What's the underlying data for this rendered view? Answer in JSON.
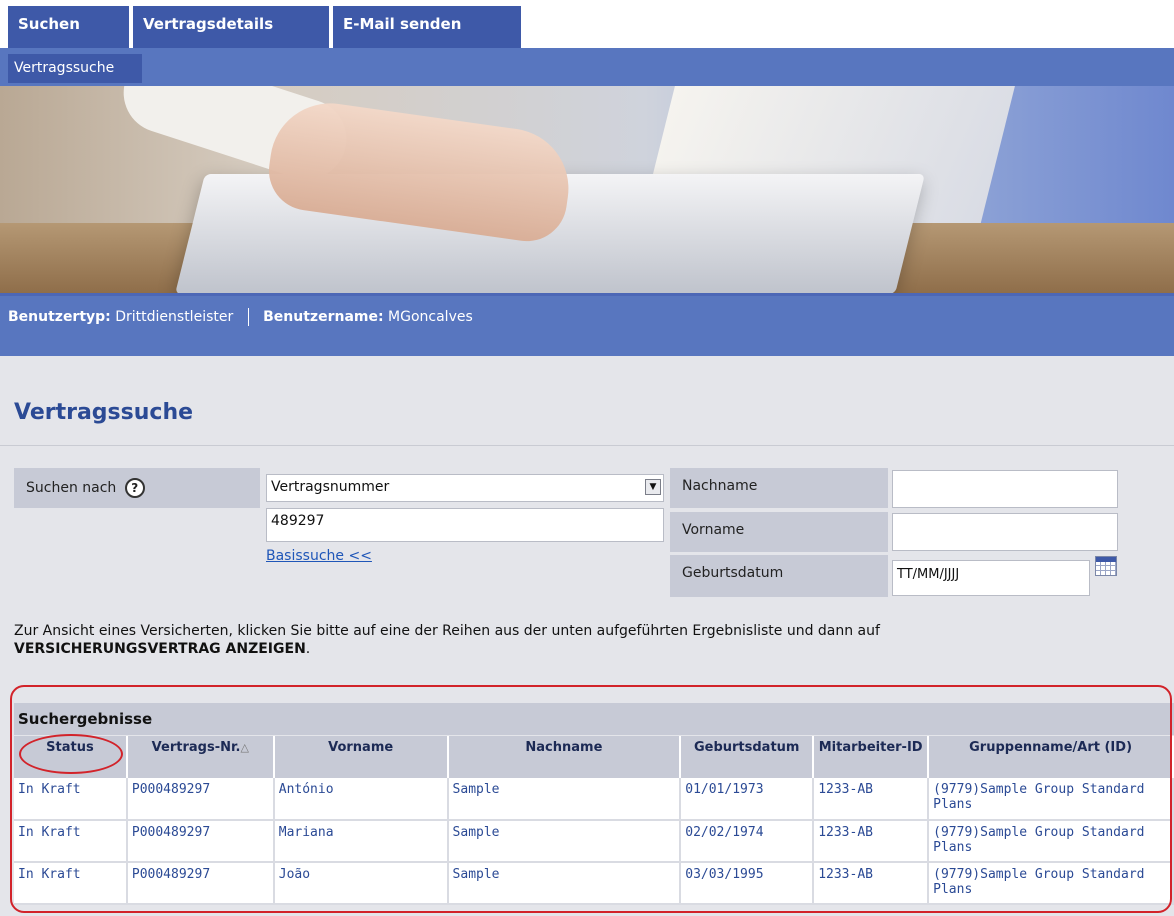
{
  "nav": {
    "tabs": [
      {
        "label": "Suchen"
      },
      {
        "label": "Vertragsdetails"
      },
      {
        "label": "E-Mail senden"
      }
    ],
    "subnav": {
      "label": "Vertragssuche"
    }
  },
  "userbar": {
    "type_label": "Benutzertyp:",
    "type_value": "Drittdienstleister",
    "name_label": "Benutzername:",
    "name_value": "MGoncalves"
  },
  "page": {
    "title": "Vertragssuche"
  },
  "search": {
    "search_by_label": "Suchen nach",
    "help_icon": "?",
    "search_type_selected": "Vertragsnummer",
    "search_value": "489297",
    "basic_search_link": "Basissuche <<",
    "lastname_label": "Nachname",
    "lastname_value": "",
    "firstname_label": "Vorname",
    "firstname_value": "",
    "dob_label": "Geburtsdatum",
    "dob_value": "TT/MM/JJJJ"
  },
  "instructions": {
    "text": "Zur Ansicht eines Versicherten, klicken Sie bitte auf eine der Reihen aus der unten aufgeführten Ergebnisliste und dann auf",
    "bold": "VERSICHERUNGSVERTRAG ANZEIGEN",
    "end": "."
  },
  "results": {
    "title": "Suchergebnisse",
    "columns": [
      "Status",
      "Vertrags-Nr.",
      "Vorname",
      "Nachname",
      "Geburtsdatum",
      "Mitarbeiter-ID",
      "Gruppenname/Art (ID)"
    ],
    "sort_icon": "△",
    "rows": [
      [
        "In Kraft",
        "P000489297",
        "António",
        "Sample",
        "01/01/1973",
        "1233-AB",
        "(9779)Sample Group Standard Plans"
      ],
      [
        "In Kraft",
        "P000489297",
        "Mariana",
        "Sample",
        "02/02/1974",
        "1233-AB",
        "(9779)Sample Group Standard Plans"
      ],
      [
        "In Kraft",
        "P000489297",
        "João",
        "Sample",
        "03/03/1995",
        "1233-AB",
        "(9779)Sample Group Standard Plans"
      ]
    ]
  },
  "colors": {
    "nav_dark": "#3e59a8",
    "nav_light": "#5876bf",
    "title_blue": "#2b4a95",
    "highlight_red": "#d2232a"
  }
}
